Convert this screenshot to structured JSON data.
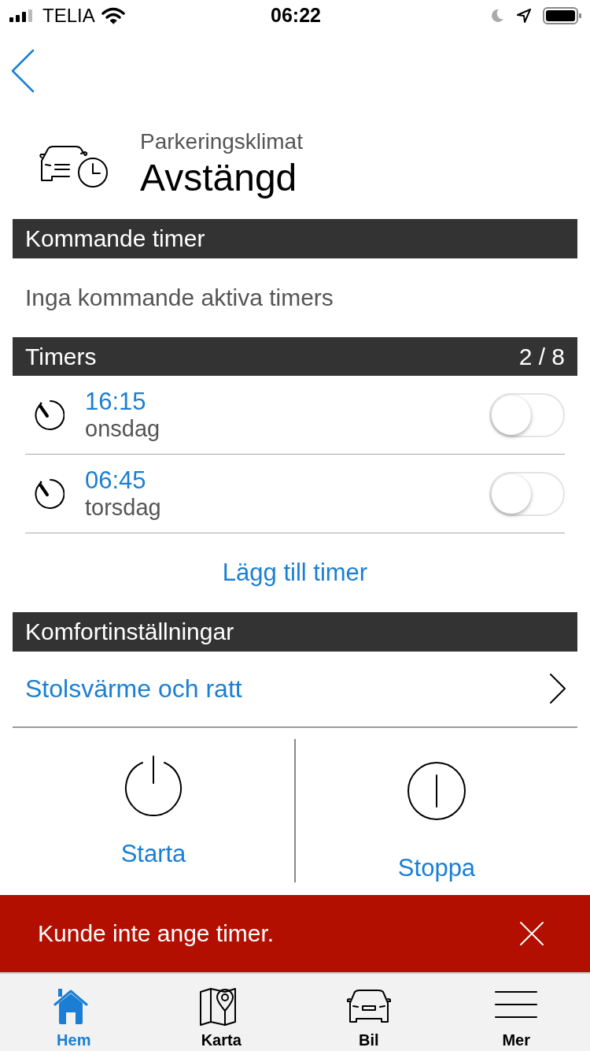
{
  "status_bar": {
    "carrier": "TELIA",
    "time": "06:22"
  },
  "header": {
    "subtitle": "Parkeringsklimat",
    "title": "Avstängd"
  },
  "upcoming": {
    "heading": "Kommande timer",
    "message": "Inga kommande aktiva timers"
  },
  "timers": {
    "heading": "Timers",
    "count": "2 / 8",
    "items": [
      {
        "time": "16:15",
        "day": "onsdag",
        "on": false
      },
      {
        "time": "06:45",
        "day": "torsdag",
        "on": false
      }
    ],
    "add_label": "Lägg till timer"
  },
  "comfort": {
    "heading": "Komfortinställningar",
    "items": [
      {
        "label": "Stolsvärme och ratt"
      }
    ]
  },
  "actions": [
    {
      "kind": "start",
      "label": "Starta"
    },
    {
      "kind": "stop",
      "label": "Stoppa"
    }
  ],
  "error_banner": {
    "message": "Kunde inte ange timer."
  },
  "tab_bar": [
    {
      "kind": "home",
      "label": "Hem",
      "selected": true
    },
    {
      "kind": "map",
      "label": "Karta",
      "selected": false
    },
    {
      "kind": "car",
      "label": "Bil",
      "selected": false
    },
    {
      "kind": "menu",
      "label": "Mer",
      "selected": false
    }
  ]
}
